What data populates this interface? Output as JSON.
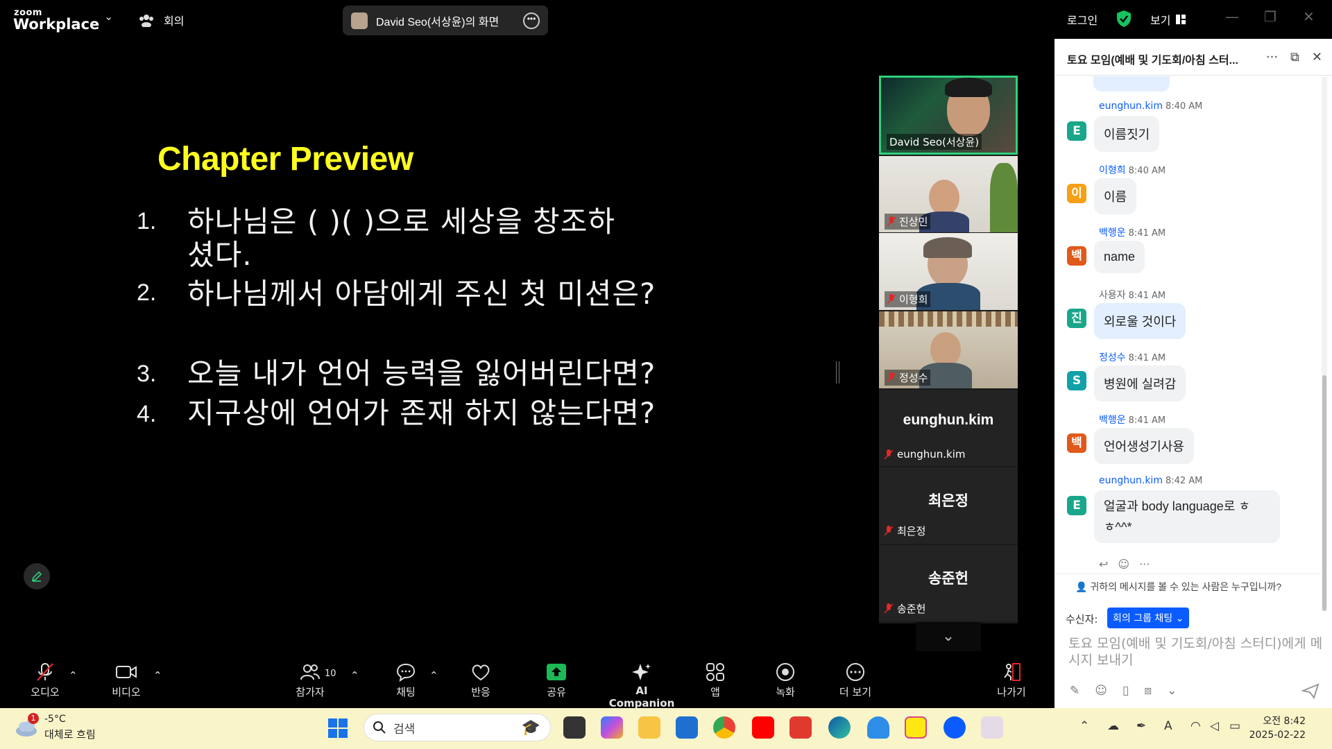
{
  "app": {
    "brand_small": "zoom",
    "brand_big": "Workplace",
    "meeting_label": "회의",
    "share_label": "David Seo(서상윤)의 화면",
    "login": "로그인",
    "view": "보기"
  },
  "slide": {
    "title": "Chapter Preview",
    "items": [
      {
        "n": "1.",
        "line1": "하나님은 (    )(    )으로 세상을 창조하",
        "line2": "셨다."
      },
      {
        "n": "2.",
        "line1": "하나님께서 아담에게 주신 첫 미션은?"
      },
      {
        "n": "3.",
        "line1": "오늘 내가 언어 능력을 잃어버린다면?"
      },
      {
        "n": "4.",
        "line1": "지구상에 언어가 존재 하지 않는다면?"
      }
    ]
  },
  "gallery": {
    "video_tiles": [
      "David Seo(서상윤)",
      "진상민",
      "이형희",
      "정성수"
    ],
    "name_tiles": [
      {
        "big": "eunghun.kim",
        "small": "eunghun.kim"
      },
      {
        "big": "최은정",
        "small": "최은정"
      },
      {
        "big": "송준헌",
        "small": "송준헌"
      }
    ]
  },
  "toolbar": {
    "audio": "오디오",
    "video": "비디오",
    "participants": "참가자",
    "participants_count": "10",
    "chat": "채팅",
    "react": "반응",
    "share": "공유",
    "ai": "AI Companion",
    "apps": "앱",
    "record": "녹화",
    "more": "더 보기",
    "leave": "나가기"
  },
  "chat": {
    "title": "토요 모임(예배 및 기도회/아침 스터...",
    "messages": [
      {
        "avatar": "E",
        "color": "#1aa68a",
        "name": "eunghun.kim",
        "time": "8:40 AM",
        "text": "이름짓기",
        "gray": false
      },
      {
        "avatar": "이",
        "color": "#f5a015",
        "name": "이형희",
        "time": "8:40 AM",
        "text": "이름",
        "gray": false
      },
      {
        "avatar": "백",
        "color": "#e0591a",
        "name": "백행운",
        "time": "8:41 AM",
        "text": "name",
        "gray": false
      },
      {
        "avatar": "진",
        "color": "#1aa68a",
        "name": "사용자",
        "time": "8:41 AM",
        "text": "외로울 것이다",
        "gray": true
      },
      {
        "avatar": "S",
        "color": "#13a0a8",
        "name": "정성수",
        "time": "8:41 AM",
        "text": "병원에 실려감",
        "gray": false
      },
      {
        "avatar": "백",
        "color": "#e0591a",
        "name": "백행운",
        "time": "8:41 AM",
        "text": "언어생성기사용",
        "gray": false
      },
      {
        "avatar": "E",
        "color": "#1aa68a",
        "name": "eunghun.kim",
        "time": "8:42 AM",
        "text": "얼굴과 body language로 ㅎ",
        "text2": "ㅎ^^*",
        "gray": false
      }
    ],
    "who_can_see": "귀하의 메시지를 볼 수 있는 사람은 누구입니까?",
    "to_label": "수신자:",
    "to_value": "회의 그룹 채팅",
    "input_placeholder": "토요 모임(예배 및 기도회/아침 스터디)에게 메시지 보내기"
  },
  "taskbar": {
    "temp": "-5°C",
    "weather": "대체로 흐림",
    "weather_badge": "1",
    "search": "검색",
    "time": "오전 8:42",
    "date": "2025-02-22"
  }
}
